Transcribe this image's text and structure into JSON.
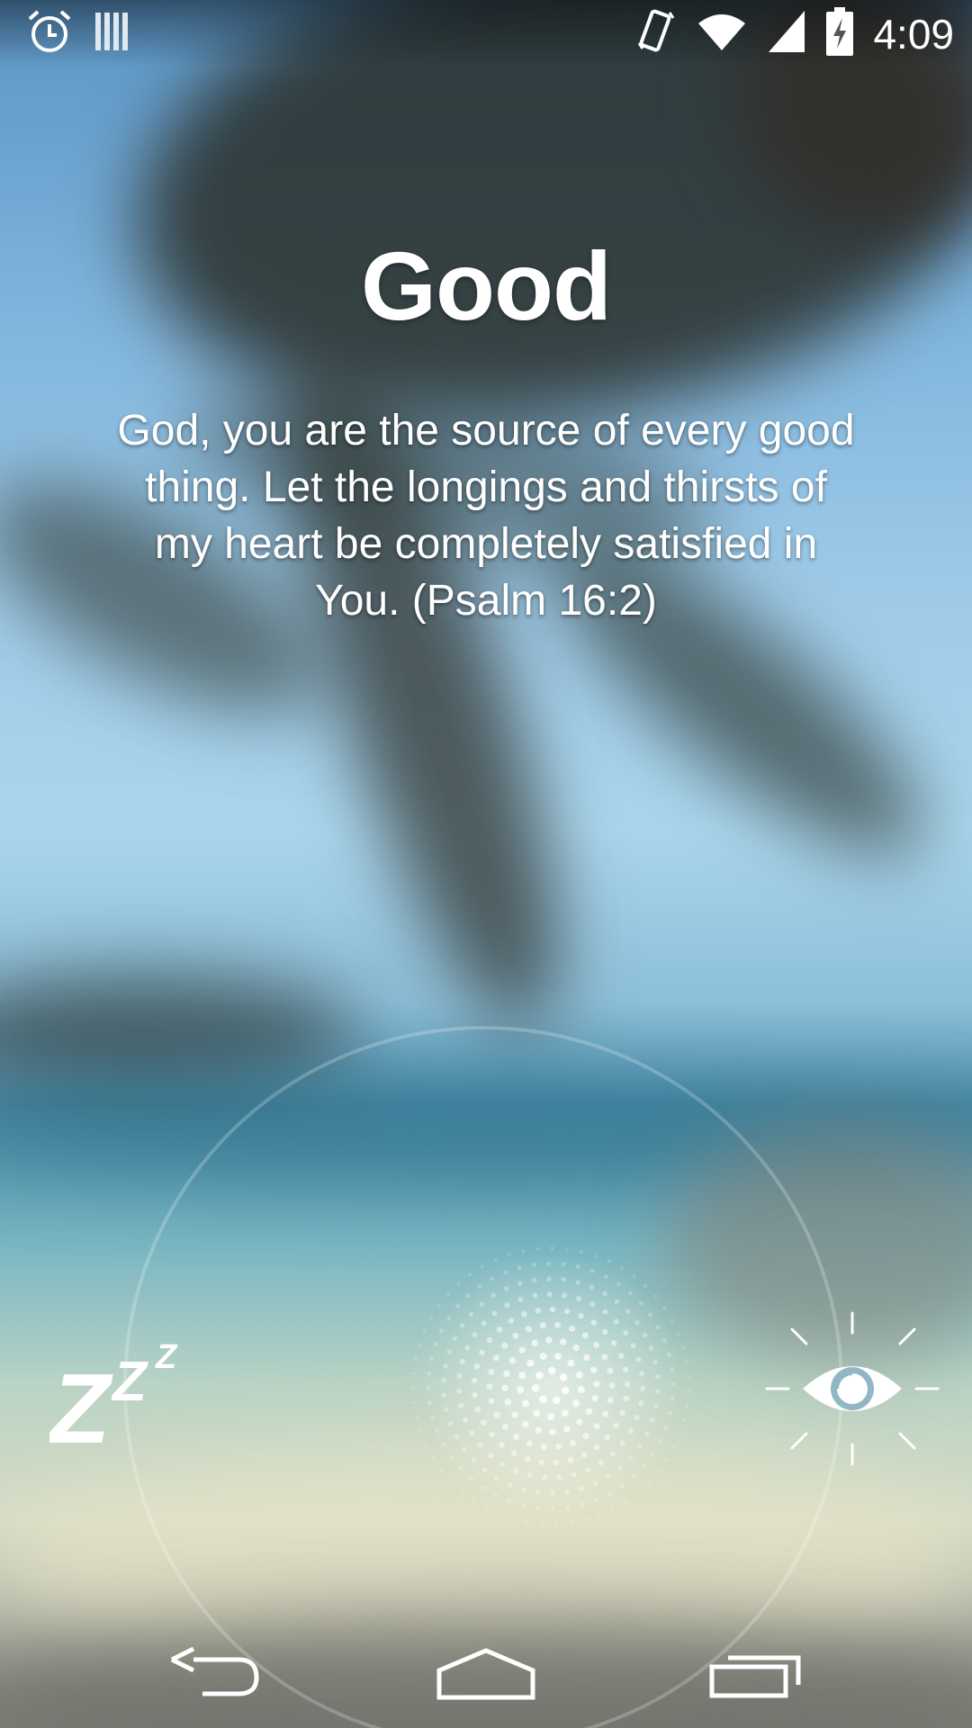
{
  "status_bar": {
    "time": "4:09",
    "left_icons": [
      "alarm-icon",
      "notification-bars-icon"
    ],
    "right_icons": [
      "vibrate-icon",
      "wifi-icon",
      "signal-icon",
      "battery-charging-icon"
    ]
  },
  "content": {
    "title": "Good",
    "verse": "God, you are the source of every good thing. Let the longings and thirsts of my heart be completely satisfied in You. (Psalm 16:2)"
  },
  "alarm_controls": {
    "snooze_icon": "zzz-snooze-icon",
    "dismiss_icon": "eye-sun-icon",
    "handle_icon": "dotted-glow-handle"
  },
  "nav_bar": {
    "buttons": [
      "back-icon",
      "home-icon",
      "recents-icon"
    ]
  },
  "colors": {
    "text": "#ffffff",
    "sky": "#9fcbe8",
    "sea": "#4f8eab",
    "sand": "#d8dcc6"
  }
}
